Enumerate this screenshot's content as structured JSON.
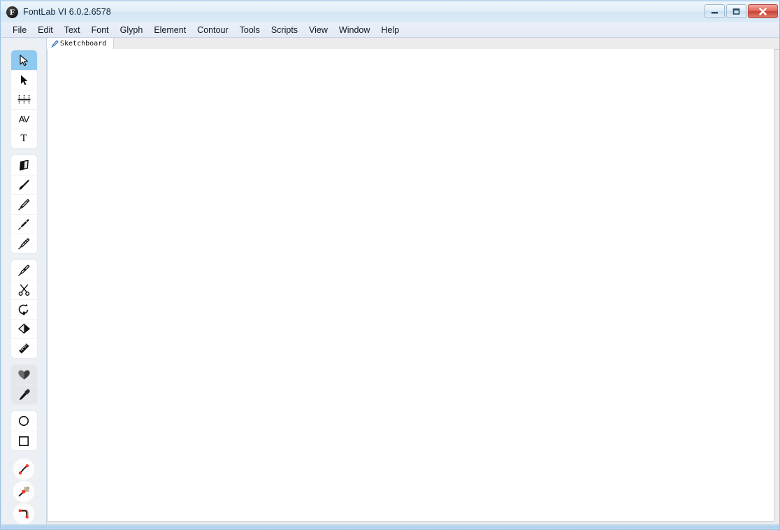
{
  "window": {
    "title": "FontLab VI 6.0.2.6578",
    "app_icon": "fontlab-logo-icon",
    "icon_letter": "F",
    "controls": [
      {
        "name": "minimize-button",
        "label": "Minimize",
        "icon": "minimize-icon"
      },
      {
        "name": "maximize-button",
        "label": "Maximize",
        "icon": "maximize-icon"
      },
      {
        "name": "close-button",
        "label": "Close",
        "icon": "close-icon"
      }
    ]
  },
  "menu": {
    "items": [
      {
        "label": "File"
      },
      {
        "label": "Edit"
      },
      {
        "label": "Text"
      },
      {
        "label": "Font"
      },
      {
        "label": "Glyph"
      },
      {
        "label": "Element"
      },
      {
        "label": "Contour"
      },
      {
        "label": "Tools"
      },
      {
        "label": "Scripts"
      },
      {
        "label": "View"
      },
      {
        "label": "Window"
      },
      {
        "label": "Help"
      }
    ]
  },
  "tabs": [
    {
      "label": "Sketchboard",
      "icon": "pen-tab-icon",
      "active": true
    }
  ],
  "toolbox": {
    "selected_tool": "edit-arrow-tool",
    "groups": [
      {
        "name": "selection-tools",
        "tools": [
          {
            "name": "edit-arrow-tool",
            "label": "Edit",
            "icon": "cursor-arrow-outline-icon",
            "selected": true
          },
          {
            "name": "select-tool",
            "label": "Select",
            "icon": "cursor-arrow-solid-icon",
            "selected": false
          },
          {
            "name": "metrics-tool",
            "label": "Metrics",
            "icon": "metrics-icon",
            "selected": false
          },
          {
            "name": "kerning-tool",
            "label": "Kerning",
            "icon": "av-kerning-icon",
            "selected": false
          },
          {
            "name": "text-tool",
            "label": "Text",
            "icon": "text-t-icon",
            "selected": false
          }
        ]
      },
      {
        "name": "drawing-tools",
        "tools": [
          {
            "name": "eraser-tool",
            "label": "Eraser",
            "icon": "eraser-icon",
            "selected": false
          },
          {
            "name": "brush-tool",
            "label": "Brush",
            "icon": "brush-icon",
            "selected": false
          },
          {
            "name": "pencil-tool",
            "label": "Pencil",
            "icon": "pencil-outline-icon",
            "selected": false
          },
          {
            "name": "power-brush-tool",
            "label": "Power Brush",
            "icon": "power-brush-icon",
            "selected": false
          },
          {
            "name": "rapid-tool",
            "label": "Rapid",
            "icon": "rapid-pen-icon",
            "selected": false
          }
        ]
      },
      {
        "name": "edit-tools",
        "tools": [
          {
            "name": "pen-tool",
            "label": "Pen",
            "icon": "pen-nib-icon",
            "selected": false
          },
          {
            "name": "knife-tool",
            "label": "Knife",
            "icon": "scissors-icon",
            "selected": false
          },
          {
            "name": "rotate-tool",
            "label": "Rotate",
            "icon": "rotate-magnet-icon",
            "selected": false
          },
          {
            "name": "paint-bucket-tool",
            "label": "Paint Bucket",
            "icon": "paint-bucket-icon",
            "selected": false
          },
          {
            "name": "measure-tool",
            "label": "Measure",
            "icon": "ruler-icon",
            "selected": false
          }
        ]
      },
      {
        "name": "shape-helpers",
        "tools": [
          {
            "name": "fill-tool",
            "label": "Fill",
            "icon": "heart-fill-icon",
            "selected": false,
            "shaded": true
          },
          {
            "name": "eyedropper-tool",
            "label": "Eyedropper",
            "icon": "eyedropper-icon",
            "selected": false,
            "shaded": true
          }
        ]
      },
      {
        "name": "primitive-tools",
        "tools": [
          {
            "name": "ellipse-tool",
            "label": "Ellipse",
            "icon": "ellipse-icon",
            "selected": false
          },
          {
            "name": "rectangle-tool",
            "label": "Rectangle",
            "icon": "rectangle-icon",
            "selected": false
          }
        ]
      },
      {
        "name": "node-tools",
        "round": true,
        "tools": [
          {
            "name": "add-node-tool",
            "label": "Add Node",
            "icon": "curve-node-icon",
            "selected": false
          },
          {
            "name": "node-type-tool",
            "label": "Node Type",
            "icon": "node-pin-icon",
            "selected": false
          },
          {
            "name": "corner-tool",
            "label": "Corner",
            "icon": "corner-curve-icon",
            "selected": false
          }
        ]
      }
    ]
  },
  "canvas": {
    "name": "sketchboard-canvas",
    "background": "#ffffff",
    "content": ""
  },
  "colors": {
    "accent": "#8ecaf0",
    "title_bar": "#e2eef8",
    "menu_bar": "#eaeff8",
    "toolbox_bg": "#eceff3",
    "canvas": "#ffffff",
    "close_button": "#c94134",
    "status_strip": "#aed0ea",
    "node_tool_red": "#e8392c"
  }
}
